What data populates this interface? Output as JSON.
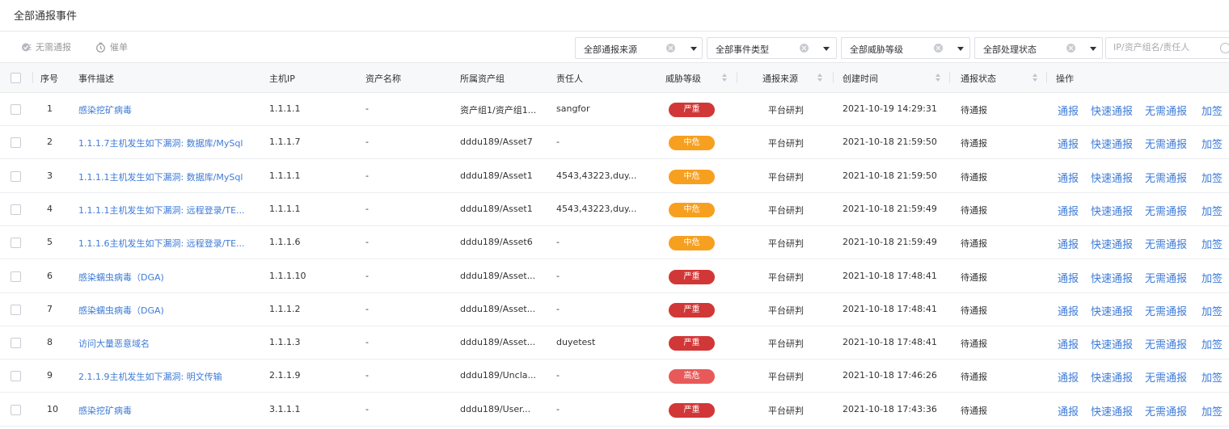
{
  "page_title": "全部通报事件",
  "toolbar": {
    "no_report_label": "无需通报",
    "remind_label": "催单",
    "filters": [
      {
        "value": "全部通报来源"
      },
      {
        "value": "全部事件类型"
      },
      {
        "value": "全部威胁等级"
      },
      {
        "value": "全部处理状态"
      }
    ],
    "search_placeholder": "IP/资产组名/责任人"
  },
  "columns": {
    "index": "序号",
    "desc": "事件描述",
    "ip": "主机IP",
    "asset": "资产名称",
    "group": "所属资产组",
    "owner": "责任人",
    "level": "威胁等级",
    "source": "通报来源",
    "created": "创建时间",
    "status": "通报状态",
    "action": "操作"
  },
  "actions": {
    "report": "通报",
    "quick_report": "快速通报",
    "no_report": "无需通报",
    "add_tag": "加签"
  },
  "level_colors": {
    "严重": "#d23737",
    "中危": "#f7a020",
    "高危": "#e85a5a"
  },
  "rows": [
    {
      "index": "1",
      "desc": "感染挖矿病毒",
      "ip": "1.1.1.1",
      "asset": "-",
      "group": "资产组1/资产组1...",
      "owner": "sangfor",
      "level": "严重",
      "source": "平台研判",
      "created": "2021-10-19 14:29:31",
      "status": "待通报"
    },
    {
      "index": "2",
      "desc": "1.1.1.7主机发生如下漏洞: 数据库/MySql",
      "ip": "1.1.1.7",
      "asset": "-",
      "group": "dddu189/Asset7",
      "owner": "-",
      "level": "中危",
      "source": "平台研判",
      "created": "2021-10-18 21:59:50",
      "status": "待通报"
    },
    {
      "index": "3",
      "desc": "1.1.1.1主机发生如下漏洞: 数据库/MySql",
      "ip": "1.1.1.1",
      "asset": "-",
      "group": "dddu189/Asset1",
      "owner": "4543,43223,duy...",
      "level": "中危",
      "source": "平台研判",
      "created": "2021-10-18 21:59:50",
      "status": "待通报"
    },
    {
      "index": "4",
      "desc": "1.1.1.1主机发生如下漏洞: 远程登录/TE...",
      "ip": "1.1.1.1",
      "asset": "-",
      "group": "dddu189/Asset1",
      "owner": "4543,43223,duy...",
      "level": "中危",
      "source": "平台研判",
      "created": "2021-10-18 21:59:49",
      "status": "待通报"
    },
    {
      "index": "5",
      "desc": "1.1.1.6主机发生如下漏洞: 远程登录/TE...",
      "ip": "1.1.1.6",
      "asset": "-",
      "group": "dddu189/Asset6",
      "owner": "-",
      "level": "中危",
      "source": "平台研判",
      "created": "2021-10-18 21:59:49",
      "status": "待通报"
    },
    {
      "index": "6",
      "desc": "感染蠕虫病毒（DGA)",
      "ip": "1.1.1.10",
      "asset": "-",
      "group": "dddu189/Asset...",
      "owner": "-",
      "level": "严重",
      "source": "平台研判",
      "created": "2021-10-18 17:48:41",
      "status": "待通报"
    },
    {
      "index": "7",
      "desc": "感染蠕虫病毒（DGA)",
      "ip": "1.1.1.2",
      "asset": "-",
      "group": "dddu189/Asset...",
      "owner": "-",
      "level": "严重",
      "source": "平台研判",
      "created": "2021-10-18 17:48:41",
      "status": "待通报"
    },
    {
      "index": "8",
      "desc": "访问大量恶意域名",
      "ip": "1.1.1.3",
      "asset": "-",
      "group": "dddu189/Asset...",
      "owner": "duyetest",
      "level": "严重",
      "source": "平台研判",
      "created": "2021-10-18 17:48:41",
      "status": "待通报"
    },
    {
      "index": "9",
      "desc": "2.1.1.9主机发生如下漏洞: 明文传输",
      "ip": "2.1.1.9",
      "asset": "-",
      "group": "dddu189/Uncla...",
      "owner": "-",
      "level": "高危",
      "source": "平台研判",
      "created": "2021-10-18 17:46:26",
      "status": "待通报"
    },
    {
      "index": "10",
      "desc": "感染挖矿病毒",
      "ip": "3.1.1.1",
      "asset": "-",
      "group": "dddu189/User...",
      "owner": "-",
      "level": "严重",
      "source": "平台研判",
      "created": "2021-10-18 17:43:36",
      "status": "待通报"
    }
  ]
}
